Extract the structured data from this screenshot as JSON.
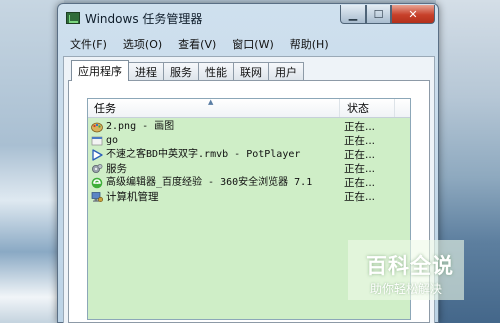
{
  "window": {
    "title": "Windows 任务管理器",
    "min_symbol": "▁",
    "max_symbol": "☐",
    "close_symbol": "✕"
  },
  "menu": [
    "文件(F)",
    "选项(O)",
    "查看(V)",
    "窗口(W)",
    "帮助(H)"
  ],
  "tabs": [
    "应用程序",
    "进程",
    "服务",
    "性能",
    "联网",
    "用户"
  ],
  "active_tab": "应用程序",
  "list": {
    "columns": {
      "task": "任务",
      "status": "状态"
    },
    "sort_indicator": "▲",
    "background": "#cfeec7",
    "rows": [
      {
        "icon": "paint-icon",
        "name": "2.png - 画图",
        "status": "正在...",
        "mono": true
      },
      {
        "icon": "go-icon",
        "name": "go",
        "status": "正在...",
        "mono": true
      },
      {
        "icon": "play-icon",
        "name": "不速之客BD中英双字.rmvb - PotPlayer",
        "status": "正在...",
        "mono": true
      },
      {
        "icon": "services-icon",
        "name": "服务",
        "status": "正在...",
        "mono": false
      },
      {
        "icon": "browser-360-icon",
        "name": "高级编辑器_百度经验 - 360安全浏览器 7.1",
        "status": "正在...",
        "mono": true
      },
      {
        "icon": "computer-management-icon",
        "name": "计算机管理",
        "status": "正在...",
        "mono": false
      }
    ]
  },
  "watermark": {
    "main": "百科全说",
    "sub": "助你轻松解决"
  }
}
